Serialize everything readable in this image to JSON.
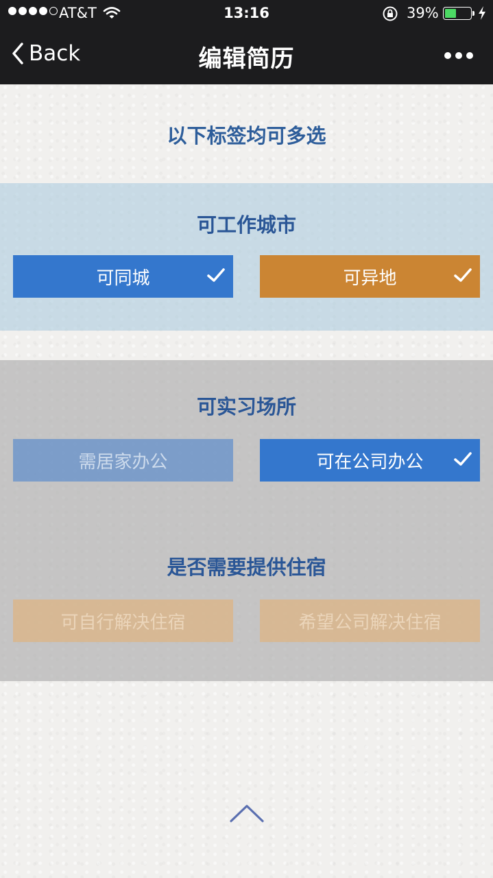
{
  "status_bar": {
    "carrier": "AT&T",
    "time": "13:16",
    "battery_percent": "39%",
    "battery_level": 0.39
  },
  "nav": {
    "back_label": "Back",
    "title": "编辑简历"
  },
  "hint": "以下标签均可多选",
  "sections": {
    "city": {
      "title": "可工作城市",
      "options": [
        {
          "label": "可同城",
          "selected": true
        },
        {
          "label": "可异地",
          "selected": true
        }
      ]
    },
    "place": {
      "title": "可实习场所",
      "options": [
        {
          "label": "需居家办公",
          "selected": false
        },
        {
          "label": "可在公司办公",
          "selected": true
        }
      ]
    },
    "housing": {
      "title": "是否需要提供住宿",
      "options": [
        {
          "label": "可自行解决住宿",
          "selected": false
        },
        {
          "label": "希望公司解决住宿",
          "selected": false
        }
      ]
    }
  },
  "colors": {
    "accent_blue": "#3477cd",
    "accent_orange": "#cb8533",
    "title_blue": "#2a5696"
  },
  "icons": [
    "back-chevron-icon",
    "more-icon",
    "checkmark-icon",
    "chevron-up-icon",
    "wifi-icon",
    "lock-rotation-icon",
    "charging-bolt-icon"
  ]
}
